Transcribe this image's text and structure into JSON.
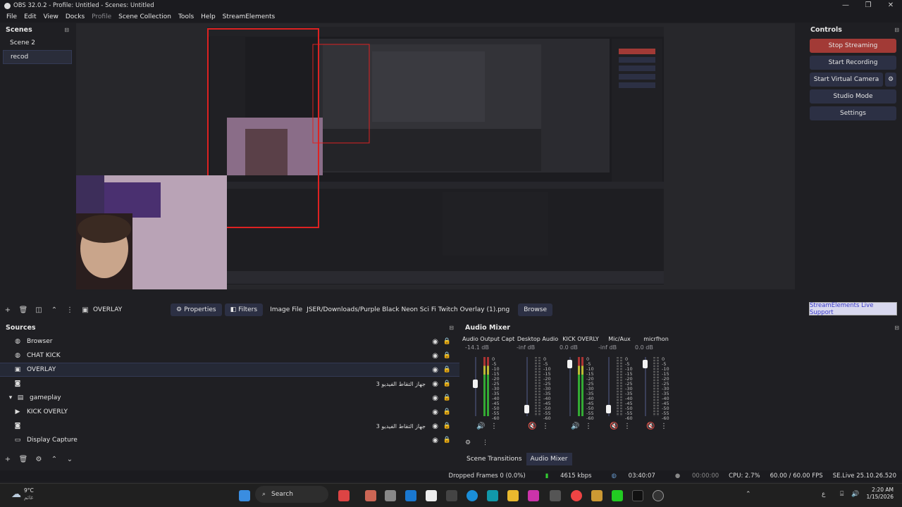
{
  "window": {
    "title": "OBS 32.0.2 - Profile: Untitled - Scenes: Untitled"
  },
  "menu": [
    "File",
    "Edit",
    "View",
    "Docks",
    "Profile",
    "Scene Collection",
    "Tools",
    "Help",
    "StreamElements"
  ],
  "scenes": {
    "title": "Scenes",
    "items": [
      "Scene 2",
      "recod"
    ],
    "selected": "recod"
  },
  "controls": {
    "title": "Controls",
    "buttons": [
      "Stop Streaming",
      "Start Recording",
      "Start Virtual Camera",
      "Studio Mode",
      "Settings"
    ],
    "support": "StreamElements Live Support"
  },
  "props": {
    "source_name": "OVERLAY",
    "properties": "Properties",
    "filters": "Filters",
    "file_label": "Image File",
    "file_path": "JSER/Downloads/Purple Black Neon Sci Fi Twitch Overlay (1).png",
    "browse": "Browse"
  },
  "sources": {
    "title": "Sources",
    "items": [
      {
        "name": "Browser",
        "icon": "globe-icon",
        "rtl": ""
      },
      {
        "name": "CHAT KICK",
        "icon": "globe-icon",
        "rtl": ""
      },
      {
        "name": "OVERLAY",
        "icon": "image-icon",
        "rtl": ""
      },
      {
        "name": "",
        "icon": "camera-icon",
        "rtl": "جهاز التقاط الفيديو 3"
      },
      {
        "name": "gameplay",
        "icon": "folder-icon",
        "rtl": ""
      },
      {
        "name": "KICK OVERLY",
        "icon": "play-icon",
        "rtl": ""
      },
      {
        "name": "",
        "icon": "camera-icon",
        "rtl": "جهاز التقاط الفيديو 3"
      },
      {
        "name": "Display Capture",
        "icon": "monitor-icon",
        "rtl": ""
      }
    ]
  },
  "mixer": {
    "title": "Audio Mixer",
    "channels": [
      {
        "name": "Audio Output Capt",
        "db": "-14.1 dB",
        "level": 0.55,
        "muted": false
      },
      {
        "name": "Desktop Audio",
        "db": "-inf dB",
        "level": 0.05,
        "muted": true
      },
      {
        "name": "KICK OVERLY",
        "db": "0.0 dB",
        "level": 0.95,
        "muted": false
      },
      {
        "name": "Mic/Aux",
        "db": "-inf dB",
        "level": 0.05,
        "muted": true
      },
      {
        "name": "micrfhon",
        "db": "0.0 dB",
        "level": 0.95,
        "muted": true
      }
    ],
    "scale": [
      "0",
      "-5",
      "-10",
      "-15",
      "-20",
      "-25",
      "-30",
      "-35",
      "-40",
      "-45",
      "-50",
      "-55",
      "-60"
    ],
    "tabs": [
      "Scene Transitions",
      "Audio Mixer"
    ]
  },
  "status": {
    "dropped": "Dropped Frames 0 (0.0%)",
    "kbps": "4615 kbps",
    "live_time": "03:40:07",
    "rec_time": "00:00:00",
    "cpu": "CPU: 2.7%",
    "fps": "60.00 / 60.00 FPS",
    "version": "SE.Live 25.10.26.520"
  },
  "taskbar": {
    "weather_temp": "9°C",
    "weather_desc": "غائم",
    "search": "Search",
    "time": "2:20 AM",
    "date": "1/15/2026",
    "lang": "ع"
  },
  "colors": {
    "accent": "#2c3044",
    "stop": "#a23a36",
    "selected": "#2a2d3a"
  }
}
